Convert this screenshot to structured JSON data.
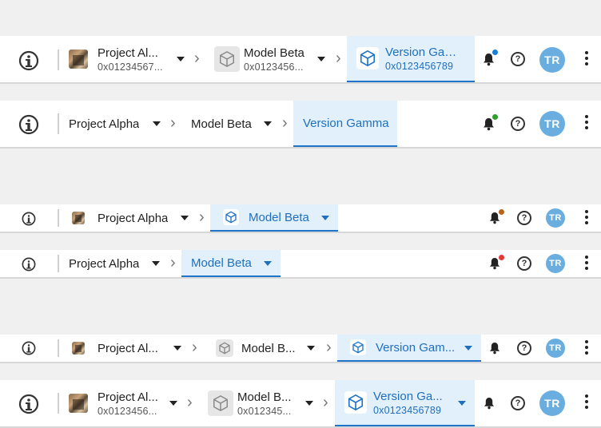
{
  "colors": {
    "accent": "#1f74c9",
    "avatar_bg": "#6aaee0",
    "active_bg": "#e2f0fb"
  },
  "icons": {
    "logo": "info-logo-icon",
    "project": "project-thumbnail",
    "model": "cube-icon",
    "chevron": "chevron-right-icon",
    "caret": "caret-down-icon",
    "bell": "bell-icon",
    "help": "help-circle-icon",
    "more": "kebab-menu-icon"
  },
  "bars": [
    {
      "project": {
        "name": "Project Al...",
        "sub": "0x01234567..."
      },
      "model": {
        "name": "Model Beta",
        "sub": "0x0123456..."
      },
      "version": {
        "name": "Version Gamm...",
        "sub": "0x0123456789"
      },
      "dot_color": "#1a7fd4",
      "avatar": "TR",
      "help": "?"
    },
    {
      "project": {
        "name": "Project Alpha"
      },
      "model": {
        "name": "Model Beta"
      },
      "version": {
        "name": "Version Gamma"
      },
      "dot_color": "#2aa12a",
      "avatar": "TR",
      "help": "?"
    },
    {
      "project": {
        "name": "Project Alpha"
      },
      "model": {
        "name": "Model Beta"
      },
      "dot_color": "#b5651d",
      "avatar": "TR",
      "help": "?"
    },
    {
      "project": {
        "name": "Project Alpha"
      },
      "model": {
        "name": "Model Beta"
      },
      "dot_color": "#e53935",
      "avatar": "TR",
      "help": "?"
    },
    {
      "project": {
        "name": "Project Al..."
      },
      "model": {
        "name": "Model B..."
      },
      "version": {
        "name": "Version Gam..."
      },
      "avatar": "TR",
      "help": "?"
    },
    {
      "project": {
        "name": "Project Al...",
        "sub": "0x0123456..."
      },
      "model": {
        "name": "Model B...",
        "sub": "0x012345..."
      },
      "version": {
        "name": "Version Ga...",
        "sub": "0x0123456789"
      },
      "avatar": "TR",
      "help": "?"
    }
  ]
}
